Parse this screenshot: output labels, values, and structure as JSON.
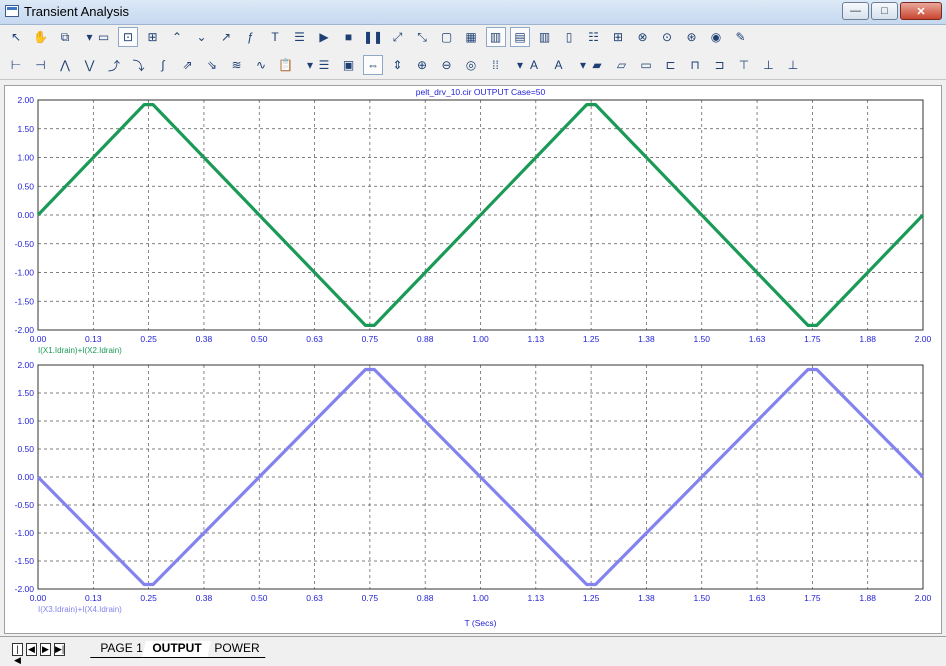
{
  "window": {
    "title": "Transient Analysis",
    "minimize_glyph": "—",
    "maximize_glyph": "□",
    "close_glyph": "✕"
  },
  "toolbar1": [
    {
      "icon": "arrow-pointer-icon",
      "glyph": "↖"
    },
    {
      "icon": "hand-pan-icon",
      "glyph": "✋"
    },
    {
      "icon": "copy-dropdown-icon",
      "glyph": "⧉"
    },
    {
      "icon": "dropdown-arrow-icon",
      "glyph": "▾"
    },
    {
      "icon": "window-icon",
      "glyph": "▭"
    },
    {
      "icon": "zoom-box-icon",
      "glyph": "⊡"
    },
    {
      "icon": "grid-dots-icon",
      "glyph": "⊞"
    },
    {
      "icon": "peak-icon",
      "glyph": "⌃"
    },
    {
      "icon": "valley-icon",
      "glyph": "⌄"
    },
    {
      "icon": "slope-icon",
      "glyph": "↗"
    },
    {
      "icon": "function-icon",
      "glyph": "ƒ"
    },
    {
      "icon": "text-icon",
      "glyph": "T"
    },
    {
      "icon": "properties-icon",
      "glyph": "☰"
    },
    {
      "icon": "run-icon",
      "glyph": "▶"
    },
    {
      "icon": "stop-icon",
      "glyph": "■"
    },
    {
      "icon": "pause-icon",
      "glyph": "❚❚"
    },
    {
      "icon": "scale-up-icon",
      "glyph": "⤢"
    },
    {
      "icon": "scale-down-icon",
      "glyph": "⤡"
    },
    {
      "icon": "frame-icon",
      "glyph": "▢"
    },
    {
      "icon": "grid-icon",
      "glyph": "▦"
    },
    {
      "icon": "align-1-icon",
      "glyph": "▥"
    },
    {
      "icon": "align-2-icon",
      "glyph": "▤"
    },
    {
      "icon": "align-3-icon",
      "glyph": "▥"
    },
    {
      "icon": "align-4-icon",
      "glyph": "▯"
    },
    {
      "icon": "rows-icon",
      "glyph": "☷"
    },
    {
      "icon": "cells-icon",
      "glyph": "⊞"
    },
    {
      "icon": "zoom-x-icon",
      "glyph": "⊗"
    },
    {
      "icon": "zoom-y-icon",
      "glyph": "⊙"
    },
    {
      "icon": "zoom-z-icon",
      "glyph": "⊛"
    },
    {
      "icon": "record-icon",
      "glyph": "◉"
    },
    {
      "icon": "edit-icon",
      "glyph": "✎"
    }
  ],
  "toolbar2": [
    {
      "icon": "cursor-left-icon",
      "glyph": "⊢"
    },
    {
      "icon": "cursor-right-icon",
      "glyph": "⊣"
    },
    {
      "icon": "peak-find-icon",
      "glyph": "⋀"
    },
    {
      "icon": "valley-find-icon",
      "glyph": "⋁"
    },
    {
      "icon": "high-icon",
      "glyph": "⤴"
    },
    {
      "icon": "low-icon",
      "glyph": "⤵"
    },
    {
      "icon": "inflection-icon",
      "glyph": "∫"
    },
    {
      "icon": "global-high-icon",
      "glyph": "⇗"
    },
    {
      "icon": "global-low-icon",
      "glyph": "⇘"
    },
    {
      "icon": "slope-find-icon",
      "glyph": "≋"
    },
    {
      "icon": "curve-icon",
      "glyph": "∿"
    },
    {
      "icon": "clipboard-icon",
      "glyph": "📋"
    },
    {
      "icon": "dropdown-arrow-icon",
      "glyph": "▾"
    },
    {
      "icon": "list-icon",
      "glyph": "☰"
    },
    {
      "icon": "calendar-icon",
      "glyph": "▣"
    },
    {
      "icon": "fit-width-icon",
      "glyph": "⇔"
    },
    {
      "icon": "fit-height-icon",
      "glyph": "⇕"
    },
    {
      "icon": "zoom-in-icon",
      "glyph": "⊕"
    },
    {
      "icon": "zoom-out-icon",
      "glyph": "⊖"
    },
    {
      "icon": "zoom-100-icon",
      "glyph": "◎"
    },
    {
      "icon": "dots-icon",
      "glyph": "⁞⁞"
    },
    {
      "icon": "dropdown-arrow-icon",
      "glyph": "▾"
    },
    {
      "icon": "font-icon",
      "glyph": "A"
    },
    {
      "icon": "font-color-icon",
      "glyph": "A"
    },
    {
      "icon": "dropdown-arrow-icon",
      "glyph": "▾"
    },
    {
      "icon": "bring-front-icon",
      "glyph": "▰"
    },
    {
      "icon": "group-icon",
      "glyph": "▱"
    },
    {
      "icon": "ungroup-icon",
      "glyph": "▭"
    },
    {
      "icon": "align-left-icon",
      "glyph": "⊏"
    },
    {
      "icon": "align-center-icon",
      "glyph": "⊓"
    },
    {
      "icon": "align-right-icon",
      "glyph": "⊐"
    },
    {
      "icon": "align-top-icon",
      "glyph": "⊤"
    },
    {
      "icon": "align-middle-icon",
      "glyph": "⊥"
    },
    {
      "icon": "align-bottom-icon",
      "glyph": "⊥"
    }
  ],
  "chart_data": [
    {
      "type": "line",
      "title": "pelt_drv_10.cir OUTPUT Case=50",
      "series": [
        {
          "name": "I(X1.Idrain)+I(X2.Idrain)",
          "color": "#1a9a56",
          "x": [
            0,
            0.24,
            0.26,
            0.74,
            0.76,
            1.24,
            1.26,
            1.74,
            1.76,
            2.0
          ],
          "y": [
            0,
            1.92,
            1.92,
            -1.92,
            -1.92,
            1.92,
            1.92,
            -1.92,
            -1.92,
            0
          ]
        }
      ],
      "xlim": [
        0,
        2.0
      ],
      "ylim": [
        -2.0,
        2.0
      ],
      "xticks": [
        "0.00",
        "0.13",
        "0.25",
        "0.38",
        "0.50",
        "0.63",
        "0.75",
        "0.88",
        "1.00",
        "1.13",
        "1.25",
        "1.38",
        "1.50",
        "1.63",
        "1.75",
        "1.88",
        "2.00"
      ],
      "yticks": [
        "2.00",
        "1.50",
        "1.00",
        "0.50",
        "0.00",
        "-0.50",
        "-1.00",
        "-1.50",
        "-2.00"
      ],
      "grid": true
    },
    {
      "type": "line",
      "series": [
        {
          "name": "I(X3.Idrain)+I(X4.Idrain)",
          "color": "#8383f0",
          "x": [
            0,
            0.24,
            0.26,
            0.74,
            0.76,
            1.24,
            1.26,
            1.74,
            1.76,
            2.0
          ],
          "y": [
            0,
            -1.92,
            -1.92,
            1.92,
            1.92,
            -1.92,
            -1.92,
            1.92,
            1.92,
            0
          ]
        }
      ],
      "xlim": [
        0,
        2.0
      ],
      "ylim": [
        -2.0,
        2.0
      ],
      "xticks": [
        "0.00",
        "0.13",
        "0.25",
        "0.38",
        "0.50",
        "0.63",
        "0.75",
        "0.88",
        "1.00",
        "1.13",
        "1.25",
        "1.38",
        "1.50",
        "1.63",
        "1.75",
        "1.88",
        "2.00"
      ],
      "yticks": [
        "2.00",
        "1.50",
        "1.00",
        "0.50",
        "0.00",
        "-0.50",
        "-1.00",
        "-1.50",
        "-2.00"
      ],
      "xlabel": "T (Secs)",
      "grid": true
    }
  ],
  "tabs": {
    "items": [
      "PAGE 1",
      "OUTPUT",
      "POWER"
    ],
    "active": "OUTPUT"
  },
  "colors": {
    "axis_text": "#1f1fd6",
    "grid": "#555555",
    "title_text": "#1f1fd6"
  }
}
